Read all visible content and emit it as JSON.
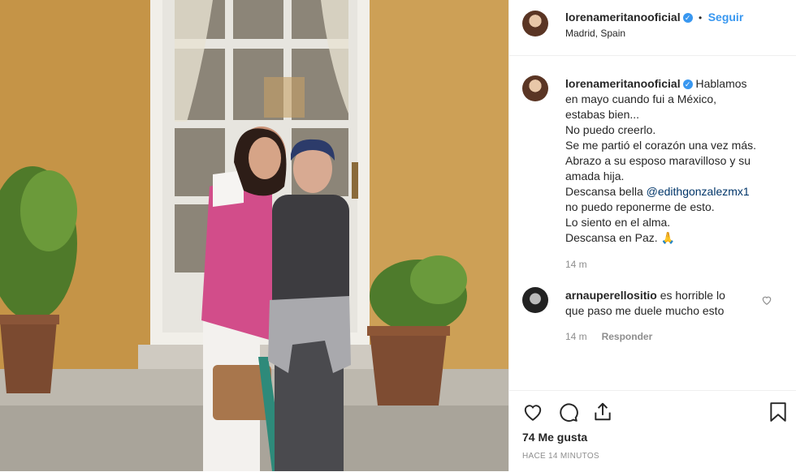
{
  "post": {
    "author": "lorenameritanooficial",
    "location": "Madrid, Spain",
    "follow_label": "Seguir",
    "dot": "•",
    "verified_glyph": "✓"
  },
  "caption": {
    "author": "lorenameritanooficial",
    "lines_first": [
      "Hablamos",
      "en mayo cuando fui a México,",
      "estabas bien...",
      "No puedo creerlo.",
      "Se me partió el corazón una vez más.",
      "Abrazo a su esposo maravilloso y su",
      "amada hija."
    ],
    "descansa_prefix": "Descansa bella",
    "mention": "@edithgonzalezmx1",
    "lines_after": [
      "no puedo reponerme de esto.",
      "Lo siento en el alma.",
      "Descansa en Paz."
    ],
    "emoji": "🙏",
    "time": "14 m"
  },
  "comment": {
    "author": "arnauperellositio",
    "text_1": "es horrible lo",
    "text_2": "que paso me duele mucho esto",
    "time": "14 m",
    "reply_label": "Responder"
  },
  "footer": {
    "likes": "74 Me gusta",
    "posted_ago": "HACE 14 MINUTOS"
  },
  "icons": {
    "like": "heart-icon",
    "comment": "comment-icon",
    "share": "share-icon",
    "save": "bookmark-icon",
    "comment_like": "small-heart-icon"
  },
  "colors": {
    "link": "#3897f0",
    "text": "#262626",
    "muted": "#8e8e8e"
  }
}
